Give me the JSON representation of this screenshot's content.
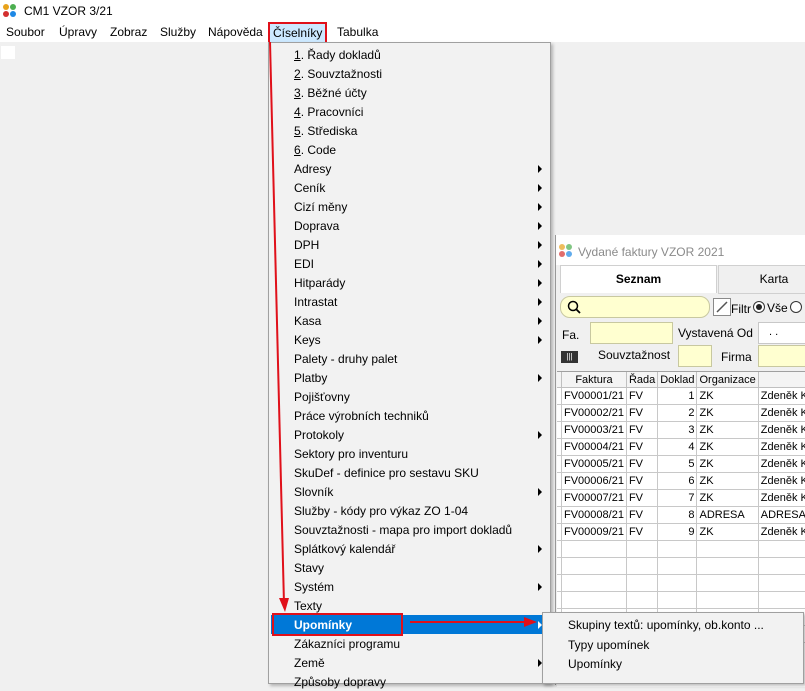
{
  "window": {
    "title": "CM1 VZOR 3/21",
    "app_icon": "flower-logo-icon"
  },
  "menubar": [
    {
      "label": "Soubor"
    },
    {
      "label": "Úpravy"
    },
    {
      "label": "Zobraz"
    },
    {
      "label": "Služby"
    },
    {
      "label": "Nápověda"
    },
    {
      "label": "Číselníky"
    },
    {
      "label": "Tabulka"
    }
  ],
  "dropdown": {
    "numbered": [
      {
        "num": "1",
        "rest": ". Řady dokladů"
      },
      {
        "num": "2",
        "rest": ". Souvztažnosti"
      },
      {
        "num": "3",
        "rest": ". Běžné účty"
      },
      {
        "num": "4",
        "rest": ". Pracovníci"
      },
      {
        "num": "5",
        "rest": ". Střediska"
      },
      {
        "num": "6",
        "rest": ". Code"
      }
    ],
    "items": [
      {
        "label": "Adresy",
        "sub": true
      },
      {
        "label": "Ceník",
        "sub": true
      },
      {
        "label": "Cizí měny",
        "sub": true
      },
      {
        "label": "Doprava",
        "sub": true
      },
      {
        "label": "DPH",
        "sub": true
      },
      {
        "label": "EDI",
        "sub": true
      },
      {
        "label": "Hitparády",
        "sub": true
      },
      {
        "label": "Intrastat",
        "sub": true
      },
      {
        "label": "Kasa",
        "sub": true
      },
      {
        "label": "Keys",
        "sub": true
      },
      {
        "label": "Palety - druhy palet",
        "sub": false
      },
      {
        "label": "Platby",
        "sub": true
      },
      {
        "label": "Pojišťovny",
        "sub": false
      },
      {
        "label": "Práce výrobních techniků",
        "sub": false
      },
      {
        "label": "Protokoly",
        "sub": true
      },
      {
        "label": "Sektory pro inventuru",
        "sub": false
      },
      {
        "label": "SkuDef - definice pro sestavu SKU",
        "sub": false
      },
      {
        "label": "Slovník",
        "sub": true
      },
      {
        "label": "Služby - kódy pro výkaz ZO 1-04",
        "sub": false
      },
      {
        "label": "Souvztažnosti - mapa pro import dokladů",
        "sub": false
      },
      {
        "label": "Splátkový kalendář",
        "sub": true
      },
      {
        "label": "Stavy",
        "sub": false
      },
      {
        "label": "Systém",
        "sub": true
      },
      {
        "label": "Texty",
        "sub": false
      },
      {
        "label": "Upomínky",
        "sub": true,
        "highlighted": true
      },
      {
        "label": "Zákazníci programu",
        "sub": false
      },
      {
        "label": "Země",
        "sub": true
      },
      {
        "label": "Způsoby dopravy",
        "sub": false
      }
    ]
  },
  "submenu": [
    {
      "label": "Skupiny textů: upomínky, ob.konto ..."
    },
    {
      "label": "Typy upomínek"
    },
    {
      "label": "Upomínky"
    }
  ],
  "subwindow": {
    "title": "Vydané faktury VZOR  2021",
    "tabs": [
      "Seznam",
      "Karta"
    ],
    "filter_label": "Filtr",
    "radio_all": "Vše",
    "fa_label": "Fa.",
    "vystavena_label": "Vystavená Od",
    "vystavena_value": ". .",
    "souvztaznost_label": "Souvztažnost",
    "firma_label": "Firma",
    "columns": [
      "Faktura",
      "Řada",
      "Doklad",
      "Organizace",
      ""
    ],
    "rows": [
      [
        "FV00001/21",
        "FV",
        "1",
        "ZK",
        "Zdeněk Kre"
      ],
      [
        "FV00002/21",
        "FV",
        "2",
        "ZK",
        "Zdeněk Kre"
      ],
      [
        "FV00003/21",
        "FV",
        "3",
        "ZK",
        "Zdeněk Kre"
      ],
      [
        "FV00004/21",
        "FV",
        "4",
        "ZK",
        "Zdeněk Kre"
      ],
      [
        "FV00005/21",
        "FV",
        "5",
        "ZK",
        "Zdeněk Kre"
      ],
      [
        "FV00006/21",
        "FV",
        "6",
        "ZK",
        "Zdeněk Kre"
      ],
      [
        "FV00007/21",
        "FV",
        "7",
        "ZK",
        "Zdeněk Kre"
      ],
      [
        "FV00008/21",
        "FV",
        "8",
        "ADRESA",
        "ADRESA"
      ],
      [
        "FV00009/21",
        "FV",
        "9",
        "ZK",
        "Zdeněk Kre"
      ]
    ]
  },
  "annotation_color": "#e0101a",
  "highlight_color": "#0078d7"
}
